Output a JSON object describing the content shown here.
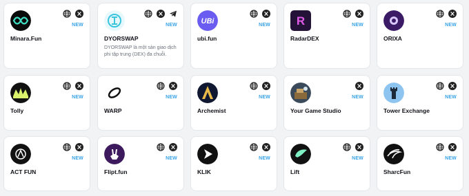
{
  "accent_color": "#3aa3e6",
  "projects": [
    {
      "name": "Minara.Fun",
      "badge": "NEW",
      "links": [
        "globe-icon",
        "x-icon"
      ],
      "logo": "minara"
    },
    {
      "name": "DYORSWAP",
      "badge": "NEW",
      "links": [
        "globe-icon",
        "x-icon",
        "telegram-icon"
      ],
      "logo": "dyorswap",
      "description": "DYORSWAP là một sàn giao dịch phi tập trung (DEX) đa chuỗi."
    },
    {
      "name": "ubi.fun",
      "badge": "NEW",
      "links": [
        "globe-icon",
        "x-icon"
      ],
      "logo": "ubi",
      "logo_text": "UBi"
    },
    {
      "name": "RadarDEX",
      "badge": "NEW",
      "links": [
        "globe-icon",
        "x-icon"
      ],
      "logo": "radar",
      "logo_text": "R"
    },
    {
      "name": "ORIXA",
      "badge": "NEW",
      "links": [
        "globe-icon",
        "x-icon"
      ],
      "logo": "orixa"
    },
    {
      "name": "Tolly",
      "badge": "NEW",
      "links": [
        "globe-icon",
        "x-icon"
      ],
      "logo": "tolly"
    },
    {
      "name": "WARP",
      "badge": "NEW",
      "links": [
        "globe-icon",
        "x-icon"
      ],
      "logo": "warp"
    },
    {
      "name": "Archemist",
      "badge": "NEW",
      "links": [
        "globe-icon",
        "x-icon"
      ],
      "logo": "archemist"
    },
    {
      "name": "Your Game Studio",
      "badge": "NEW",
      "links": [
        "x-icon"
      ],
      "logo": "studio"
    },
    {
      "name": "Tower Exchange",
      "badge": "NEW",
      "links": [
        "globe-icon",
        "x-icon"
      ],
      "logo": "tower"
    },
    {
      "name": "ACT FUN",
      "badge": "NEW",
      "links": [
        "globe-icon",
        "x-icon"
      ],
      "logo": "act"
    },
    {
      "name": "Flipt.fun",
      "badge": "NEW",
      "links": [
        "globe-icon",
        "x-icon"
      ],
      "logo": "flipt"
    },
    {
      "name": "KLIK",
      "badge": "NEW",
      "links": [
        "globe-icon",
        "x-icon"
      ],
      "logo": "klik"
    },
    {
      "name": "Lift",
      "badge": "NEW",
      "links": [
        "globe-icon",
        "x-icon"
      ],
      "logo": "lift"
    },
    {
      "name": "SharcFun",
      "badge": "NEW",
      "links": [
        "globe-icon",
        "x-icon"
      ],
      "logo": "sharc"
    }
  ]
}
